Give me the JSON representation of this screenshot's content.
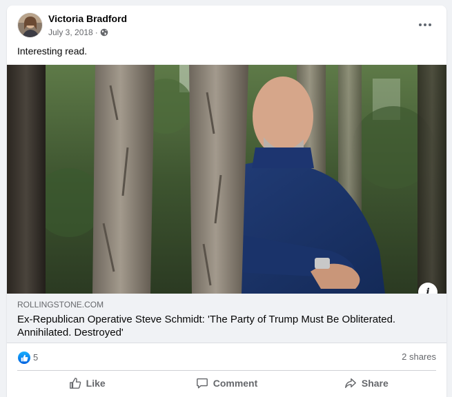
{
  "post": {
    "author": "Victoria Bradford",
    "date": "July 3, 2018",
    "separator": "·",
    "privacy_icon": "globe-icon",
    "text": "Interesting read."
  },
  "link": {
    "domain": "ROLLINGSTONE.COM",
    "title": "Ex-Republican Operative Steve Schmidt: 'The Party of Trump Must Be Obliterated. Annihilated. Destroyed'",
    "info_label": "i"
  },
  "stats": {
    "reaction_icon": "like-icon",
    "reaction_count": "5",
    "shares": "2 shares"
  },
  "actions": {
    "like": "Like",
    "comment": "Comment",
    "share": "Share"
  },
  "colors": {
    "accent": "#1877f2",
    "muted_text": "#65676b",
    "preview_bg": "#f0f2f5"
  }
}
